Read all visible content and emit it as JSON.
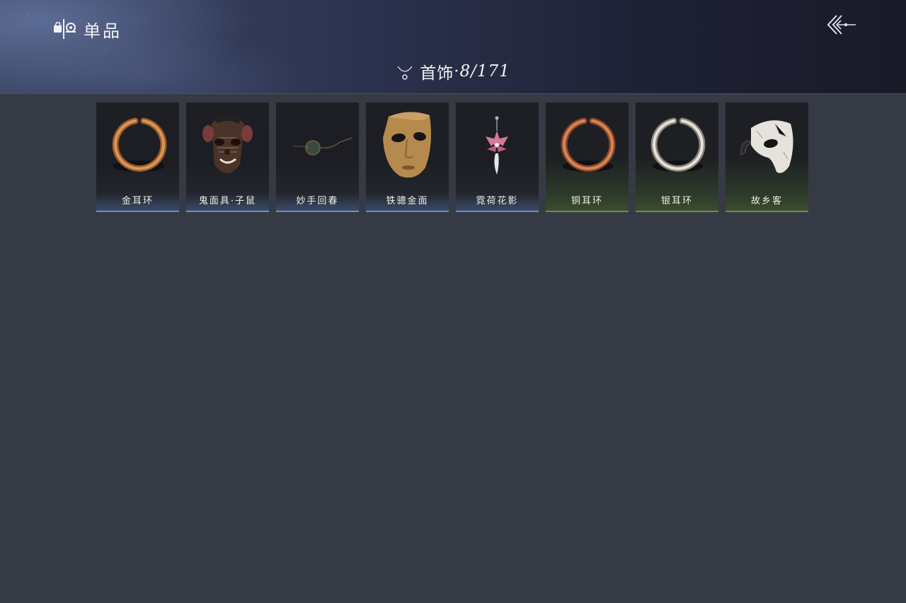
{
  "header": {
    "title": "单品",
    "brand_icon": "collection-icon",
    "back_icon": "back-arrow-icon"
  },
  "category": {
    "icon": "necklace-icon",
    "name": "首饰",
    "separator": "·",
    "count": "8/171"
  },
  "items": [
    {
      "name": "金耳环",
      "icon": "gold-earring-icon",
      "rarity_color": "#6d8fbf"
    },
    {
      "name": "鬼面具·子鼠",
      "icon": "rat-mask-icon",
      "rarity_color": "#6d8fbf"
    },
    {
      "name": "妙手回春",
      "icon": "glasses-icon",
      "rarity_color": "#6d8fbf"
    },
    {
      "name": "铁骢金面",
      "icon": "golden-mask-icon",
      "rarity_color": "#6d8fbf"
    },
    {
      "name": "霓荷花影",
      "icon": "lotus-pendant-icon",
      "rarity_color": "#6d8fbf"
    },
    {
      "name": "铜耳环",
      "icon": "copper-earring-icon",
      "rarity_color": "#728a52"
    },
    {
      "name": "银耳环",
      "icon": "silver-earring-icon",
      "rarity_color": "#728a52"
    },
    {
      "name": "故乡客",
      "icon": "white-half-mask-icon",
      "rarity_color": "#728a52"
    }
  ]
}
